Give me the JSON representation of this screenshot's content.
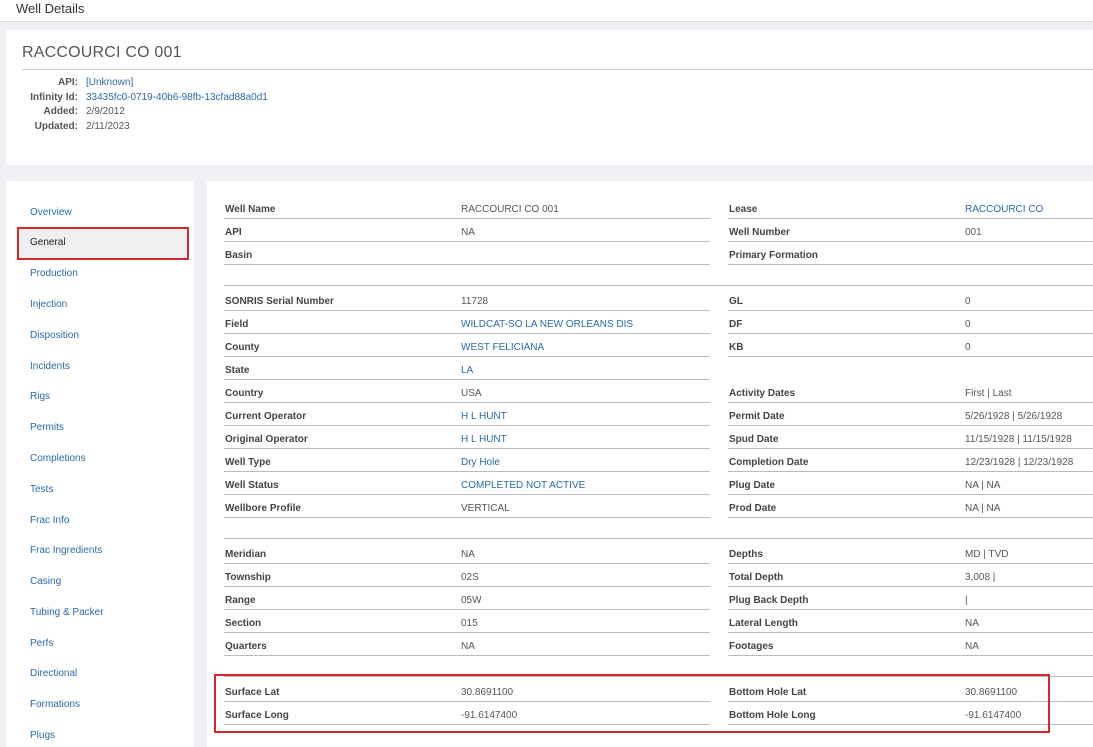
{
  "topbar": {
    "title": "Well Details"
  },
  "header": {
    "well_name": "RACCOURCI CO 001",
    "meta": [
      {
        "label": "API:",
        "value": "[Unknown]",
        "link": true
      },
      {
        "label": "Infinity Id:",
        "value": "33435fc0-0719-40b6-98fb-13cfad88a0d1",
        "link": true
      },
      {
        "label": "Added:",
        "value": "2/9/2012",
        "link": false
      },
      {
        "label": "Updated:",
        "value": "2/11/2023",
        "link": false
      }
    ]
  },
  "sidebar": {
    "items": [
      "Overview",
      "General",
      "Production",
      "Injection",
      "Disposition",
      "Incidents",
      "Rigs",
      "Permits",
      "Completions",
      "Tests",
      "Frac Info",
      "Frac Ingredients",
      "Casing",
      "Tubing & Packer",
      "Perfs",
      "Directional",
      "Formations",
      "Plugs"
    ],
    "active": "General"
  },
  "details": {
    "rows": [
      {
        "l1": "Well Name",
        "v1": "RACCOURCI CO 001",
        "l2": "Lease",
        "v2": "RACCOURCI CO",
        "v2_link": true
      },
      {
        "l1": "API",
        "v1": "NA",
        "l2": "Well Number",
        "v2": "001"
      },
      {
        "l1": "Basin",
        "v1": "",
        "l2": "Primary Formation",
        "v2": ""
      },
      {
        "l1": "SONRIS Serial Number",
        "v1": "11728",
        "l2": "GL",
        "v2": "0"
      },
      {
        "l1": "Field",
        "v1": "WILDCAT-SO LA NEW ORLEANS DIS",
        "v1_link": true,
        "l2": "DF",
        "v2": "0"
      },
      {
        "l1": "County",
        "v1": "WEST FELICIANA",
        "v1_link": true,
        "l2": "KB",
        "v2": "0"
      },
      {
        "l1": "State",
        "v1": "LA",
        "v1_link": true,
        "l2": "",
        "v2": ""
      },
      {
        "l1": "Country",
        "v1": "USA",
        "l2": "Activity Dates",
        "v2": "First | Last"
      },
      {
        "l1": "Current Operator",
        "v1": "H L HUNT",
        "v1_link": true,
        "l2": "Permit Date",
        "v2": "5/26/1928 | 5/26/1928"
      },
      {
        "l1": "Original Operator",
        "v1": "H L HUNT",
        "v1_link": true,
        "l2": "Spud Date",
        "v2": "11/15/1928 | 11/15/1928"
      },
      {
        "l1": "Well Type",
        "v1": "Dry Hole",
        "v1_link": true,
        "l2": "Completion Date",
        "v2": "12/23/1928 | 12/23/1928"
      },
      {
        "l1": "Well Status",
        "v1": "COMPLETED NOT ACTIVE",
        "v1_link": true,
        "l2": "Plug Date",
        "v2": "NA | NA"
      },
      {
        "l1": "Wellbore Profile",
        "v1": "VERTICAL",
        "l2": "Prod Date",
        "v2": "NA | NA"
      },
      {
        "l1": "Meridian",
        "v1": "NA",
        "l2": "Depths",
        "v2": "MD | TVD"
      },
      {
        "l1": "Township",
        "v1": "02S",
        "l2": "Total Depth",
        "v2": "3,008 |"
      },
      {
        "l1": "Range",
        "v1": "05W",
        "l2": "Plug Back Depth",
        "v2": "|"
      },
      {
        "l1": "Section",
        "v1": "015",
        "l2": "Lateral Length",
        "v2": "NA"
      },
      {
        "l1": "Quarters",
        "v1": "NA",
        "l2": "Footages",
        "v2": "NA"
      },
      {
        "l1": "Surface Lat",
        "v1": "30.8691100",
        "l2": "Bottom Hole Lat",
        "v2": "30.8691100"
      },
      {
        "l1": "Surface Long",
        "v1": "-91.6147400",
        "l2": "Bottom Hole Long",
        "v2": "-91.6147400"
      }
    ]
  },
  "highlight_color": "#d9262c",
  "link_color": "#2a6aa8"
}
